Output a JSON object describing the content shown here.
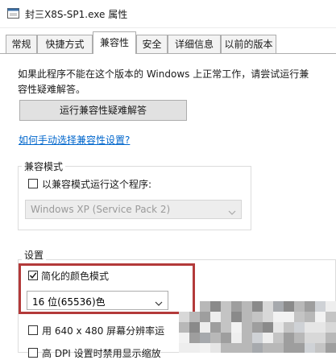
{
  "window": {
    "title": "封三X8S-SP1.exe 属性",
    "icon": "application-icon"
  },
  "tabs": [
    {
      "label": "常规",
      "active": false
    },
    {
      "label": "快捷方式",
      "active": false
    },
    {
      "label": "兼容性",
      "active": true
    },
    {
      "label": "安全",
      "active": false
    },
    {
      "label": "详细信息",
      "active": false
    },
    {
      "label": "以前的版本",
      "active": false
    }
  ],
  "compat": {
    "description": "如果此程序不能在这个版本的 Windows 上正常工作，请尝试运行兼容性疑难解答。",
    "troubleshoot_button": "运行兼容性疑难解答",
    "manual_link": "如何手动选择兼容性设置?"
  },
  "compat_mode": {
    "group_label": "兼容模式",
    "checkbox_label": "以兼容模式运行这个程序:",
    "checked": false,
    "os_select_value": "Windows XP (Service Pack 2)",
    "os_select_disabled": true
  },
  "settings": {
    "group_label": "设置",
    "reduced_color": {
      "label": "简化的颜色模式",
      "checked": true
    },
    "color_select_value": "16 位(65536)色",
    "res_640": {
      "label": "用 640 x 480 屏幕分辨率运",
      "checked": false
    },
    "dpi": {
      "label": "高 DPI 设置时禁用显示缩放",
      "checked": false
    }
  },
  "colors": {
    "highlight_border": "#b33a3a",
    "link": "#0066cc"
  }
}
